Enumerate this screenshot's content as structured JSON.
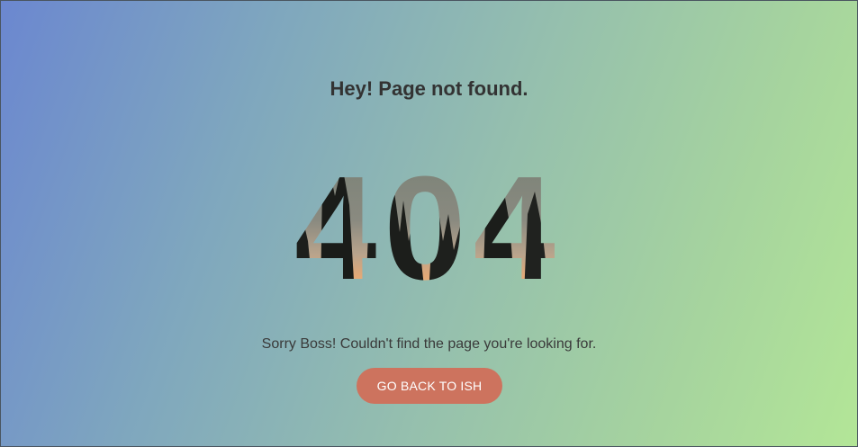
{
  "page": {
    "heading": "Hey! Page not found.",
    "error_code": "404",
    "message": "Sorry Boss! Couldn't find the page you're looking for.",
    "back_button_label": "GO BACK TO ISH"
  },
  "colors": {
    "gradient_start": "#6b87d0",
    "gradient_end": "#b3e697",
    "heading_text": "#333333",
    "button_bg": "#cd735e",
    "button_text": "#ffffff"
  }
}
